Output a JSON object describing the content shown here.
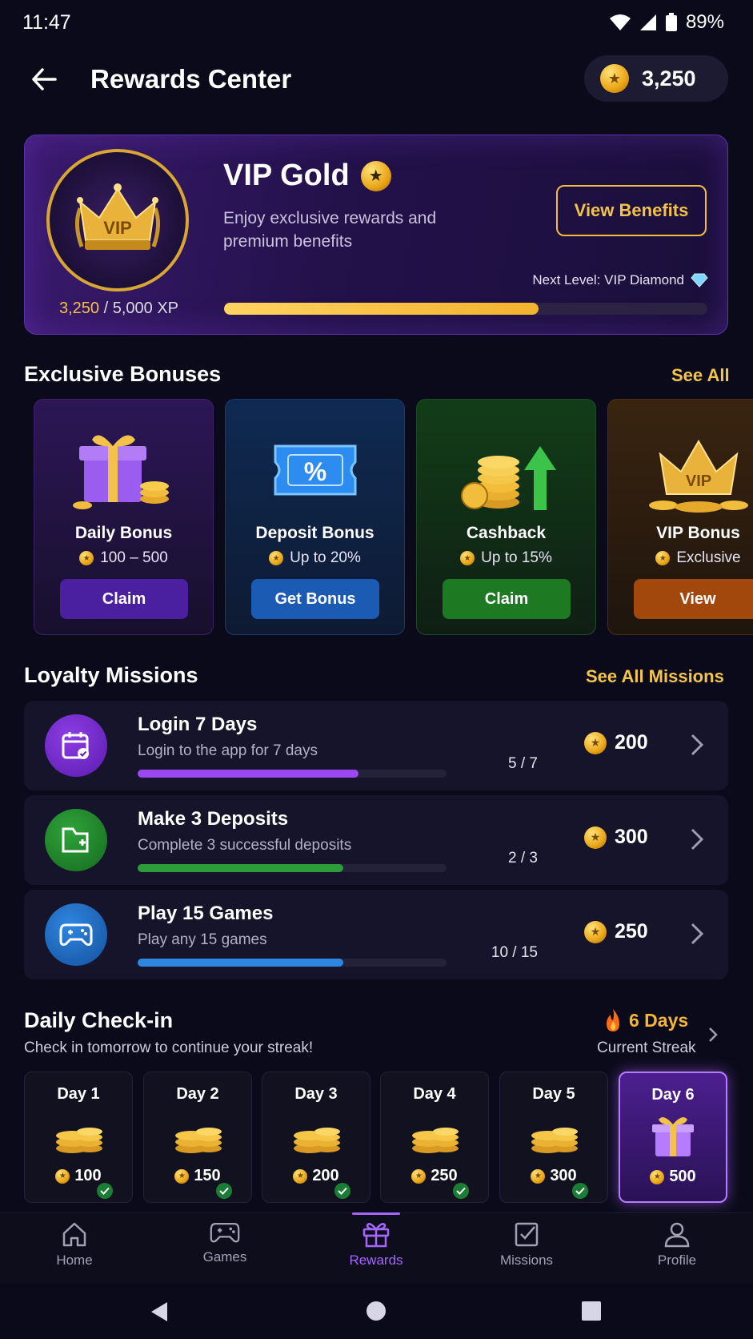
{
  "status": {
    "time": "11:47",
    "battery": "89%"
  },
  "header": {
    "title": "Rewards Center",
    "coins": "3,250"
  },
  "vip": {
    "title": "VIP Gold",
    "badge_text": "VIP",
    "subtitle": "Enjoy exclusive rewards and premium benefits",
    "button": "View Benefits",
    "next_level": "Next Level: VIP Diamond",
    "xp_current": "3,250",
    "xp_total": " / 5,000 XP",
    "progress": 0.65
  },
  "bonuses": {
    "title": "Exclusive Bonuses",
    "see_all": "See All",
    "items": [
      {
        "name": "Daily Bonus",
        "amount": "100 – 500",
        "button": "Claim",
        "accent": "#4a1fa0"
      },
      {
        "name": "Deposit Bonus",
        "amount": "Up to 20%",
        "button": "Get Bonus",
        "accent": "#1c5bb3"
      },
      {
        "name": "Cashback",
        "amount": "Up to 15%",
        "button": "Claim",
        "accent": "#1d7a23"
      },
      {
        "name": "VIP Bonus",
        "amount": "Exclusive",
        "button": "View",
        "accent": "#a2480c"
      }
    ]
  },
  "missions": {
    "title": "Loyalty Missions",
    "see_all": "See All Missions",
    "items": [
      {
        "title": "Login 7 Days",
        "desc": "Login to the app for 7 days",
        "count": "5 / 7",
        "reward": "200",
        "progress": 0.714,
        "color": "#9a48f0",
        "icon": "calendar-check-icon"
      },
      {
        "title": "Make 3 Deposits",
        "desc": "Complete 3 successful deposits",
        "count": "2 / 3",
        "reward": "300",
        "progress": 0.667,
        "color": "#2e9c3a",
        "icon": "wallet-plus-icon"
      },
      {
        "title": "Play 15 Games",
        "desc": "Play any 15 games",
        "count": "10 / 15",
        "reward": "250",
        "progress": 0.667,
        "color": "#2f86e0",
        "icon": "gamepad-icon"
      }
    ]
  },
  "checkin": {
    "title": "Daily Check-in",
    "subtitle": "Check in tomorrow to continue your streak!",
    "streak": "6 Days",
    "streak_label": "Current Streak",
    "days": [
      {
        "label": "Day 1",
        "amount": "100",
        "claimed": true
      },
      {
        "label": "Day 2",
        "amount": "150",
        "claimed": true
      },
      {
        "label": "Day 3",
        "amount": "200",
        "claimed": true
      },
      {
        "label": "Day 4",
        "amount": "250",
        "claimed": true
      },
      {
        "label": "Day 5",
        "amount": "300",
        "claimed": true
      },
      {
        "label": "Day 6",
        "amount": "500",
        "claimed": false
      }
    ]
  },
  "nav": {
    "items": [
      {
        "label": "Home",
        "icon": "home-icon"
      },
      {
        "label": "Games",
        "icon": "gamepad-icon"
      },
      {
        "label": "Rewards",
        "icon": "gift-icon",
        "active": true
      },
      {
        "label": "Missions",
        "icon": "checklist-icon"
      },
      {
        "label": "Profile",
        "icon": "profile-icon"
      }
    ]
  }
}
